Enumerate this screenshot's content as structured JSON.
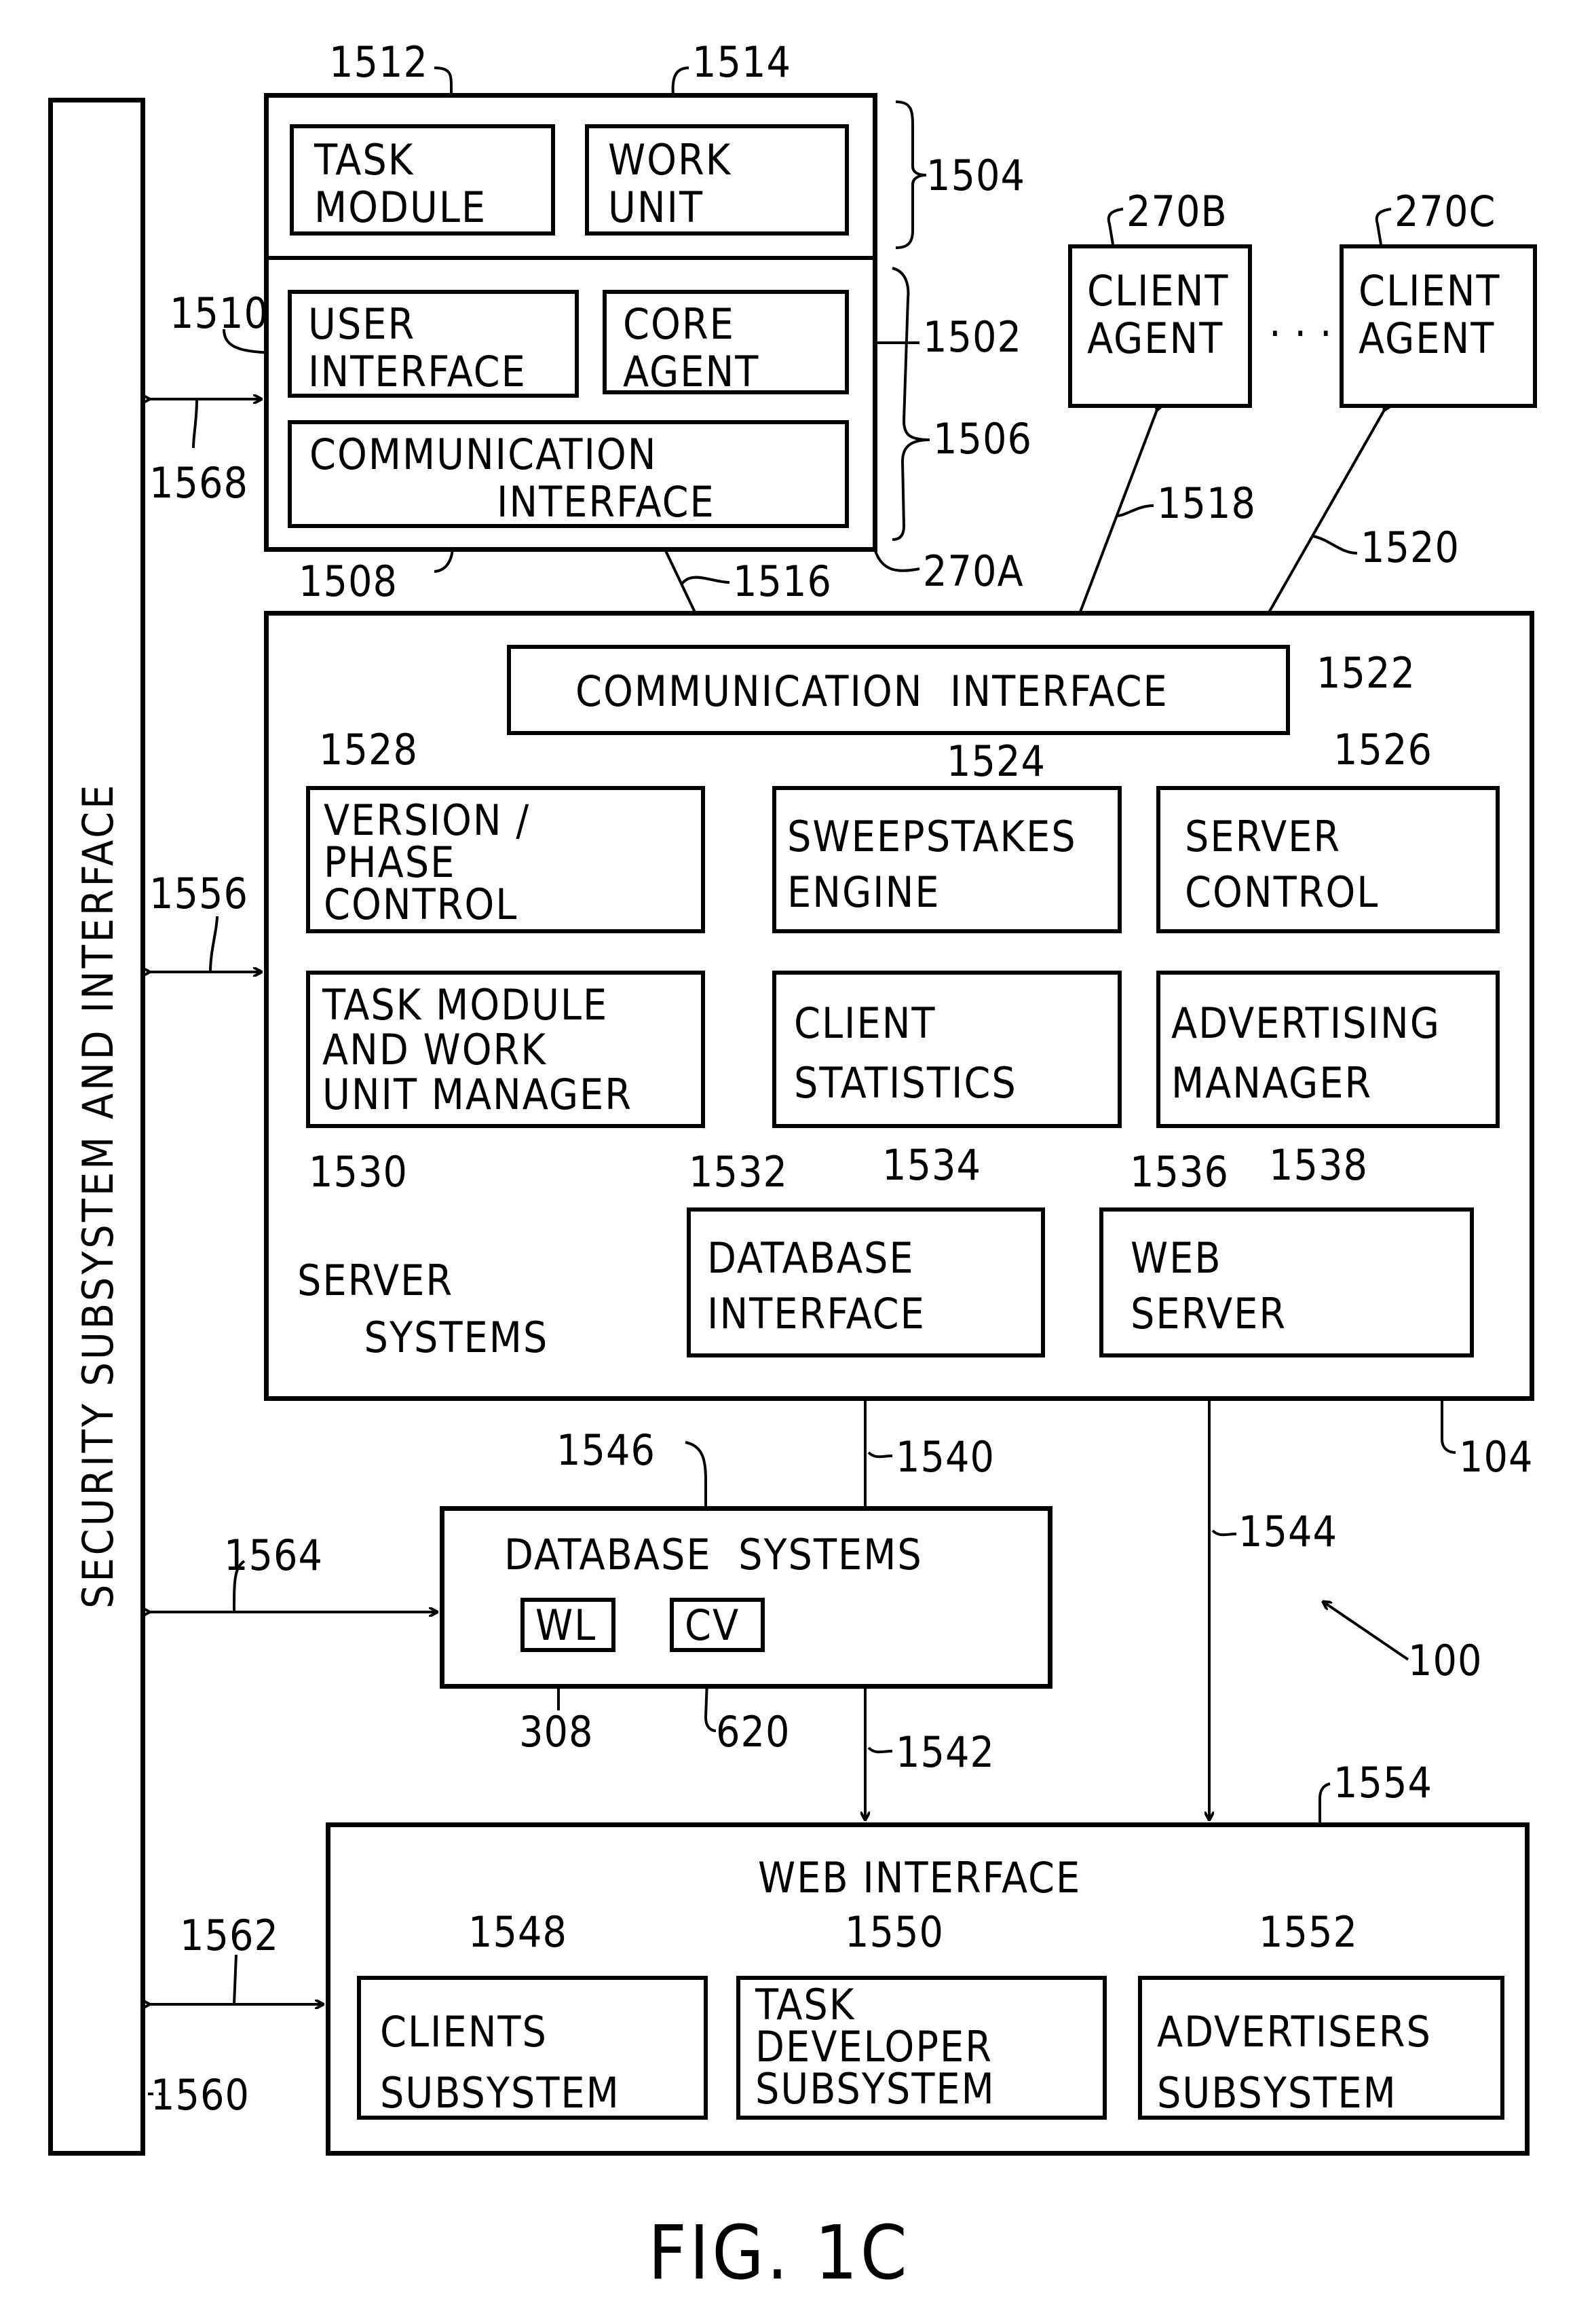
{
  "figure_label": "FIG. 1C",
  "system_ref": "100",
  "security": {
    "label": "SECURITY SUBSYSTEM AND INTERFACE",
    "ref": "1560"
  },
  "agent": {
    "ref": "270A",
    "upper_group_ref": "1504",
    "lower_group_ref": "1506",
    "task_module": {
      "label": "TASK\nMODULE",
      "ref": "1512"
    },
    "work_unit": {
      "label": "WORK\nUNIT",
      "ref": "1514"
    },
    "user_interface": {
      "label": "USER\nINTERFACE",
      "ref": "1510"
    },
    "core_agent": {
      "label": "CORE\nAGENT",
      "ref": "1502"
    },
    "comm_interface": {
      "label": "COMMUNICATION\n              INTERFACE",
      "ref": "1508"
    }
  },
  "client_agents": [
    {
      "label": "CLIENT\nAGENT",
      "ref": "270B",
      "link_ref": "1518"
    },
    {
      "label": "CLIENT\nAGENT",
      "ref": "270C",
      "link_ref": "1520"
    }
  ],
  "ellipsis": "· · ·",
  "links": {
    "agent_to_server": "1516",
    "security_to_agent": "1568",
    "security_to_server": "1556",
    "security_to_db": "1564",
    "security_to_web": "1562",
    "dbif_to_db": "1540",
    "db_to_web": "1542",
    "webserver_to_web": "1544"
  },
  "server": {
    "ref": "104",
    "label": "SERVER\n     SYSTEMS",
    "comm_interface": {
      "label": "COMMUNICATION  INTERFACE",
      "ref": "1522"
    },
    "modules": [
      {
        "id": "version",
        "label": "VERSION /\nPHASE\nCONTROL",
        "ref": "1528"
      },
      {
        "id": "sweepstakes",
        "label": "SWEEPSTAKES\nENGINE",
        "ref": "1524"
      },
      {
        "id": "server_control",
        "label": "SERVER\nCONTROL",
        "ref": "1526"
      },
      {
        "id": "task_manager",
        "label": "TASK MODULE\nAND WORK\nUNIT MANAGER",
        "ref": "1530"
      },
      {
        "id": "client_stats",
        "label": "CLIENT\nSTATISTICS",
        "ref": "1534"
      },
      {
        "id": "advertising",
        "label": "ADVERTISING\nMANAGER",
        "ref": "1538"
      },
      {
        "id": "db_interface",
        "label": "DATABASE\nINTERFACE",
        "ref": "1532"
      },
      {
        "id": "web_server",
        "label": "WEB\nSERVER",
        "ref": "1536"
      }
    ]
  },
  "database": {
    "label": "DATABASE  SYSTEMS",
    "ref": "1546",
    "items": [
      {
        "label": "WL",
        "ref": "308"
      },
      {
        "label": "CV",
        "ref": "620"
      }
    ]
  },
  "web_interface": {
    "label": "WEB INTERFACE",
    "ref": "1554",
    "subsystems": [
      {
        "label": "CLIENTS\nSUBSYSTEM",
        "ref": "1548"
      },
      {
        "label": "TASK\nDEVELOPER\nSUBSYSTEM",
        "ref": "1550"
      },
      {
        "label": "ADVERTISERS\nSUBSYSTEM",
        "ref": "1552"
      }
    ]
  }
}
